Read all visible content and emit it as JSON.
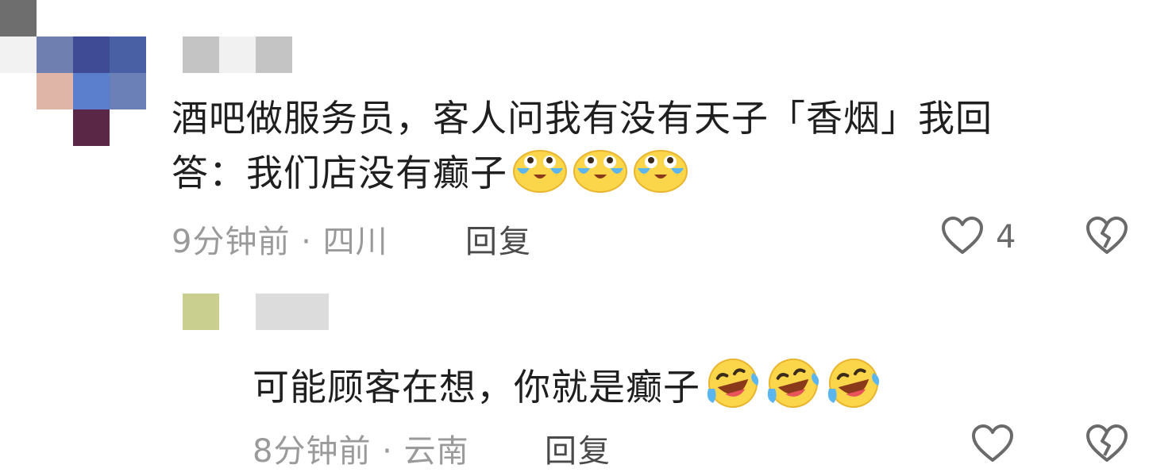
{
  "comment": {
    "text_line1": "酒吧做服务员，客人问我有没有天子「香烟」我回",
    "text_line2": "答：我们店没有癫子",
    "emoji_name": "crying-emoji",
    "time": "9分钟前",
    "location": "四川",
    "separator": "·",
    "reply_label": "回复",
    "like_count": "4"
  },
  "reply": {
    "text": "可能顾客在想，你就是癫子",
    "emoji_name": "laughing-tears-emoji",
    "time": "8分钟前",
    "location": "云南",
    "separator": "·",
    "reply_label": "回复"
  },
  "colors": {
    "text": "#1f1f1f",
    "meta": "#9a9a9a",
    "icon": "#6a6a6a",
    "emoji_yellow": "#fbd64a"
  },
  "icons": [
    "heart-icon",
    "broken-heart-icon"
  ]
}
